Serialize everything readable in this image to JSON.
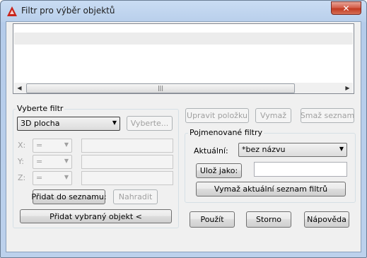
{
  "window": {
    "title": "Filtr pro výběr objektů",
    "close_glyph": "✕"
  },
  "list": {
    "scroll_left": "◀",
    "scroll_right": "▶",
    "thumb_grip": "|||"
  },
  "select_filter": {
    "group_label": "Vyberte filtr",
    "object_type": "3D plocha",
    "select_button": "Vyberte...",
    "coords": [
      {
        "label": "X:",
        "operator": "="
      },
      {
        "label": "Y:",
        "operator": "="
      },
      {
        "label": "Z:",
        "operator": "="
      }
    ],
    "add_to_list_button": "Přidat do seznamu:",
    "replace_button": "Nahradit",
    "add_selected_button": "Přidat vybraný objekt <"
  },
  "list_actions": {
    "edit_item": "Upravit položku",
    "delete": "Vymaž",
    "clear_list": "Smaž seznam"
  },
  "named_filters": {
    "group_label": "Pojmenované filtry",
    "current_label": "Aktuální:",
    "current_value": "*bez názvu",
    "save_as_button": "Ulož jako:",
    "save_as_value": "",
    "delete_current_button": "Vymaž aktuální seznam filtrů"
  },
  "footer": {
    "apply": "Použít",
    "cancel": "Storno",
    "help": "Nápověda"
  },
  "colors": {
    "title_bar": "#c9dcf3",
    "close_button": "#c23a22",
    "dialog_bg": "#f0f0f0"
  }
}
